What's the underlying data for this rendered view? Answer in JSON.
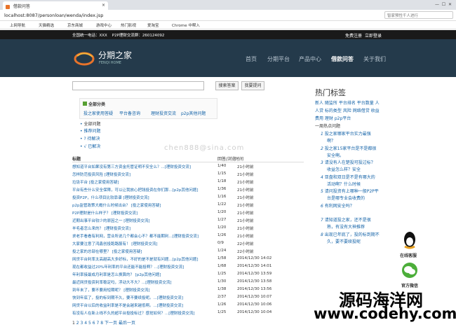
{
  "browser": {
    "tab_title": "借款问答",
    "url": "localhost:8087/personloan/wenda/index.jsp",
    "search_placeholder": "智家预性千人进行",
    "bookmarks": [
      "应用",
      "上网导航",
      "天猫精选",
      "京东商城",
      "游戏中心",
      "热门影视",
      "爱淘宝",
      "Chrome 中帮入"
    ]
  },
  "topbar": {
    "left": "全国统一电话：XXX    P2P理财交流群：260124092",
    "register": "免费注册",
    "login": "立即登录"
  },
  "header": {
    "logo_title": "分期之家",
    "logo_sub": "FENQI HOME",
    "nav": [
      "首页",
      "分期平台",
      "产品中心",
      "借款问答",
      "关于我们"
    ],
    "active": "借款问答"
  },
  "search": {
    "value": "",
    "search_button": "搜索答案",
    "ask_button": "我要提问"
  },
  "categories": {
    "title": "全部分类",
    "items": [
      "投之家使用答疑",
      "平台备咨询",
      "理财投资交流",
      "p2p其他问题"
    ]
  },
  "filters": [
    "全部问题",
    "推荐问题",
    "待解决",
    "已解决"
  ],
  "table": {
    "headers": [
      "标题",
      "回答/浏览",
      "时间"
    ],
    "rows": [
      [
        "想知道平台如果没有第三方资金托管证明不安全么？...[理财投资交流]",
        "1/40",
        "21小时前"
      ],
      [
        "怎样防范投资风险 [理财投资交流]",
        "1/15",
        "21小时前"
      ],
      [
        "垃圾平台 [投之家使用答疑]",
        "1/18",
        "21小时前"
      ],
      [
        "平台有些什么安全保障，可以让我放心把钱投资在你们那...[p2p其他问题]",
        "1/36",
        "21小时前"
      ],
      [
        "投资P2P，什么项目比较靠谱 [理财投资交流]",
        "1/16",
        "21小时前"
      ],
      [
        "p2p监管政策大概什么时候出台？ [投之家使用答疑]",
        "1/22",
        "21小时前"
      ],
      [
        "P2P理财是什么样子？ [理财投资交流]",
        "1/20",
        "21小时前"
      ],
      [
        "近期出事平台较少的原因之一 [理财投资交流]",
        "1/27",
        "21小时前"
      ],
      [
        "羊毛者怎么来的？ [理财投资交流]",
        "1/20",
        "21小时前"
      ],
      [
        "求老手看看有利网，营业所说几个都会心不？都不能期利...[理财投资交流]",
        "1/26",
        "21小时前"
      ],
      [
        "大家要注意了鸿鑫创投跑路服有！ [理财投资交流]",
        "0/9",
        "22小时前"
      ],
      [
        "投之家的总部在哪里？ [投之家使用答疑]",
        "1/24",
        "22小时前"
      ],
      [
        "网贷平台利率太高越高大多好标，不好的是不是就有问题...[p2p其他问题]",
        "1/58",
        "2014/12/30 14:02"
      ],
      [
        "现在都收益过20%年利率的平台还能不能投啊？...[理财投资交流]",
        "1/68",
        "2014/12/30 14:01"
      ],
      [
        "年利率接最成月利率是怎么换算的？ [p2p其他问题]",
        "1/25",
        "2014/12/30 13:59"
      ],
      [
        "最近网贷投资利率稳定吗，浮动大不大？...[理财投资交流]",
        "1/30",
        "2014/12/30 13:58"
      ],
      [
        "到年末了，要不要用短期呢？ [理财投资交流]",
        "1/38",
        "2014/12/30 13:56"
      ],
      [
        "快到年底了，投的标到期不久，要不要续投呢。...[理财投资交流]",
        "2/37",
        "2014/12/30 10:07"
      ],
      [
        "网贷平台以后的收益利率是不是会越来越低啊。...[理财投资交流]",
        "1/26",
        "2014/12/30 10:06"
      ],
      [
        "有没有人在新上线不久的超平台投投标过？感觉如何？...[理财投资交流]",
        "1/25",
        "2014/12/30 10:04"
      ]
    ]
  },
  "pagination": [
    "1",
    "2",
    "3",
    "4",
    "5",
    "6",
    "7",
    "8",
    "下一页",
    "最后一页"
  ],
  "sidebar": {
    "title": "热门标签",
    "tags_line1": "新人 随监所 平台排名 平台数量 人",
    "tags_line2": "人贷 标的类型 风险 网络借贷 收益",
    "tags_line3": "费用 理财 p2p平台",
    "section": "一周热点问题",
    "questions": [
      [
        "1",
        "投之家哪家平台实力最强",
        "啊？"
      ],
      [
        "2",
        "投之家15家平台是不是都很",
        "安全啊。"
      ],
      [
        "3",
        "请没有人在楚投可投过标？",
        "收益怎么样？安全"
      ],
      [
        "4",
        "亚盘和双日是不是有哪大的",
        "活动啊？什么时候"
      ],
      [
        "5",
        "请问投资有上哪种一般P2P平",
        "台是哪专业会收费的"
      ],
      [
        "6",
        "有利网安全吗？",
        ""
      ],
      [
        "7",
        "请知道投之家，还不是很",
        "熟，有没有大神推荐"
      ],
      [
        "8",
        "出现已年底了，投的标到期不",
        "久，要不要续投呢"
      ]
    ],
    "qq_label": "在线客服",
    "wx_label": "官方微信"
  },
  "watermark": {
    "line1": "源码海洋网",
    "line2": "www.codehy.com",
    "middle": "chen888@sina.com"
  },
  "colors": {
    "header_bg": "#243a4b",
    "topbar_bg": "#1a1a1a",
    "link": "#1463a8",
    "logo_accent": "#e8732a"
  }
}
